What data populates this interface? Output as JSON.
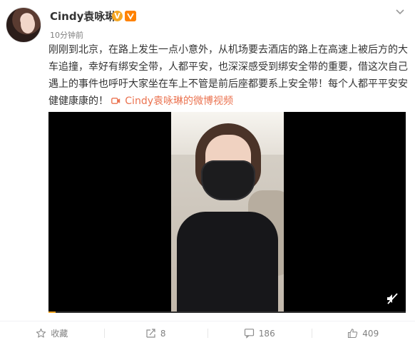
{
  "user": {
    "name": "Cindy袁咏琳",
    "verified_badge": "V",
    "vip_badge": "",
    "timestamp": "10分钟前"
  },
  "post": {
    "text": "刚刚到北京，在路上发生一点小意外，从机场要去酒店的路上在高速上被后方的大车追撞，幸好有绑安全带，人都平安，也深深感受到绑安全带的重要，借这次自己遇上的事件也呼吁大家坐在车上不管是前后座都要系上安全带！每个人都平平安安健健康康的！",
    "video_link_label": "Cindy袁咏琳的微博视频"
  },
  "video": {
    "progress_fraction": 0.02
  },
  "actions": {
    "favorite_label": "收藏",
    "repost_count": "8",
    "comment_count": "186",
    "like_count": "409"
  },
  "icons": {
    "dropdown": "chevron-down-icon",
    "video_link": "video-camera-icon",
    "mute": "volume-muted-icon",
    "favorite": "star-icon",
    "repost": "share-icon",
    "comment": "comment-icon",
    "like": "thumbs-up-icon"
  },
  "colors": {
    "link": "#eb7350",
    "badge": "#f5a623",
    "text": "#333333",
    "muted": "#808080"
  }
}
